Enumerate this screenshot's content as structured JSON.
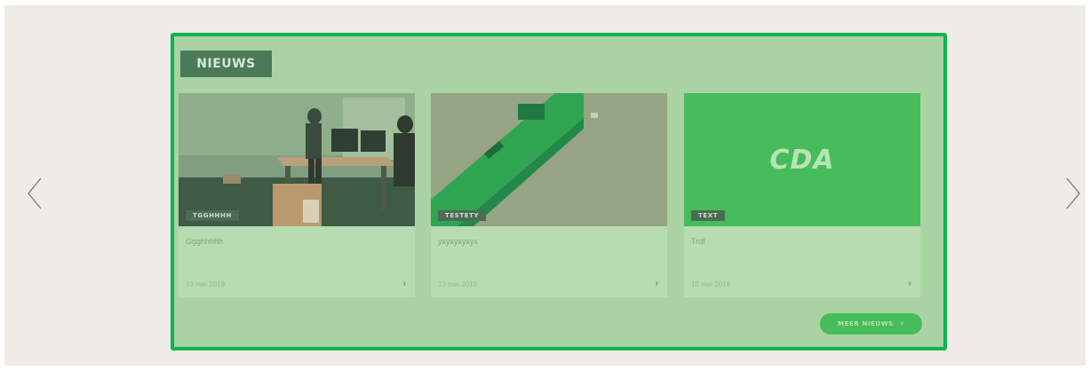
{
  "carousel": {
    "prev_icon": "chevron-left-icon",
    "next_icon": "chevron-right-icon"
  },
  "news": {
    "heading": "NIEUWS",
    "items": [
      {
        "tag": "TGGHHHH",
        "title": "Ggghhhhh",
        "date": "13 mei 2019",
        "image": "office-photo"
      },
      {
        "tag": "TESTETY",
        "title": "yxyxyxyxyx",
        "date": "13 mei 2019",
        "image": "green-object-photo"
      },
      {
        "tag": "TEXT",
        "title": "Trdf",
        "date": "10 mei 2019",
        "image": "cda-logo",
        "logo_text": "CDA"
      }
    ],
    "more_label": "MEER NIEUWS",
    "more_chevron": "›"
  },
  "colors": {
    "accent": "#0ab550",
    "panel": "#aad3a4",
    "brand_green": "#46bd5a",
    "background": "#efebe6"
  }
}
